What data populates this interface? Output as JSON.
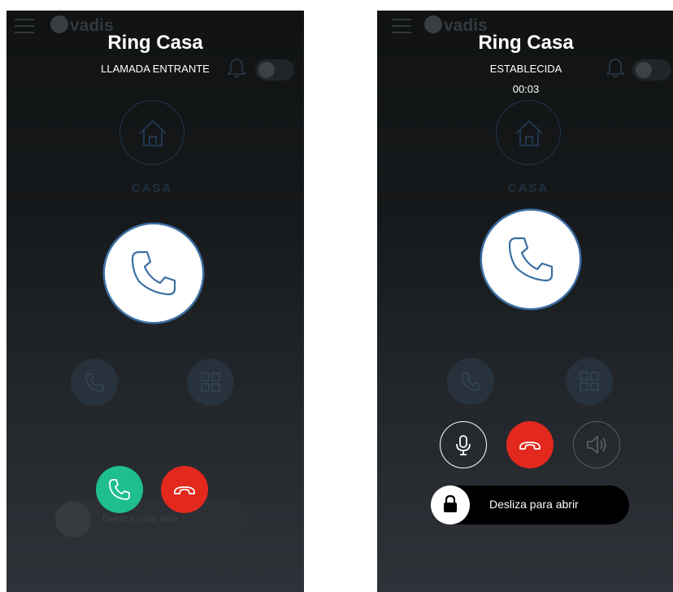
{
  "app": {
    "logo_text": "vadis"
  },
  "incoming": {
    "title": "Ring Casa",
    "status": "LLAMADA ENTRANTE",
    "background_label": "CASA",
    "background_slider_text": "Desliza para abrir"
  },
  "established": {
    "title": "Ring Casa",
    "status": "ESTABLECIDA",
    "timer": "00:03",
    "background_label": "CASA",
    "slider_text": "Desliza para abrir"
  },
  "colors": {
    "accept": "#1fbe8d",
    "reject": "#e3281d",
    "phone_ring": "#3b6fa3",
    "slider": "#000000"
  },
  "icons": [
    "menu-icon",
    "bell-icon",
    "home-icon",
    "phone-icon",
    "grid-icon",
    "hangup-icon",
    "microphone-icon",
    "speaker-icon",
    "lock-icon"
  ]
}
